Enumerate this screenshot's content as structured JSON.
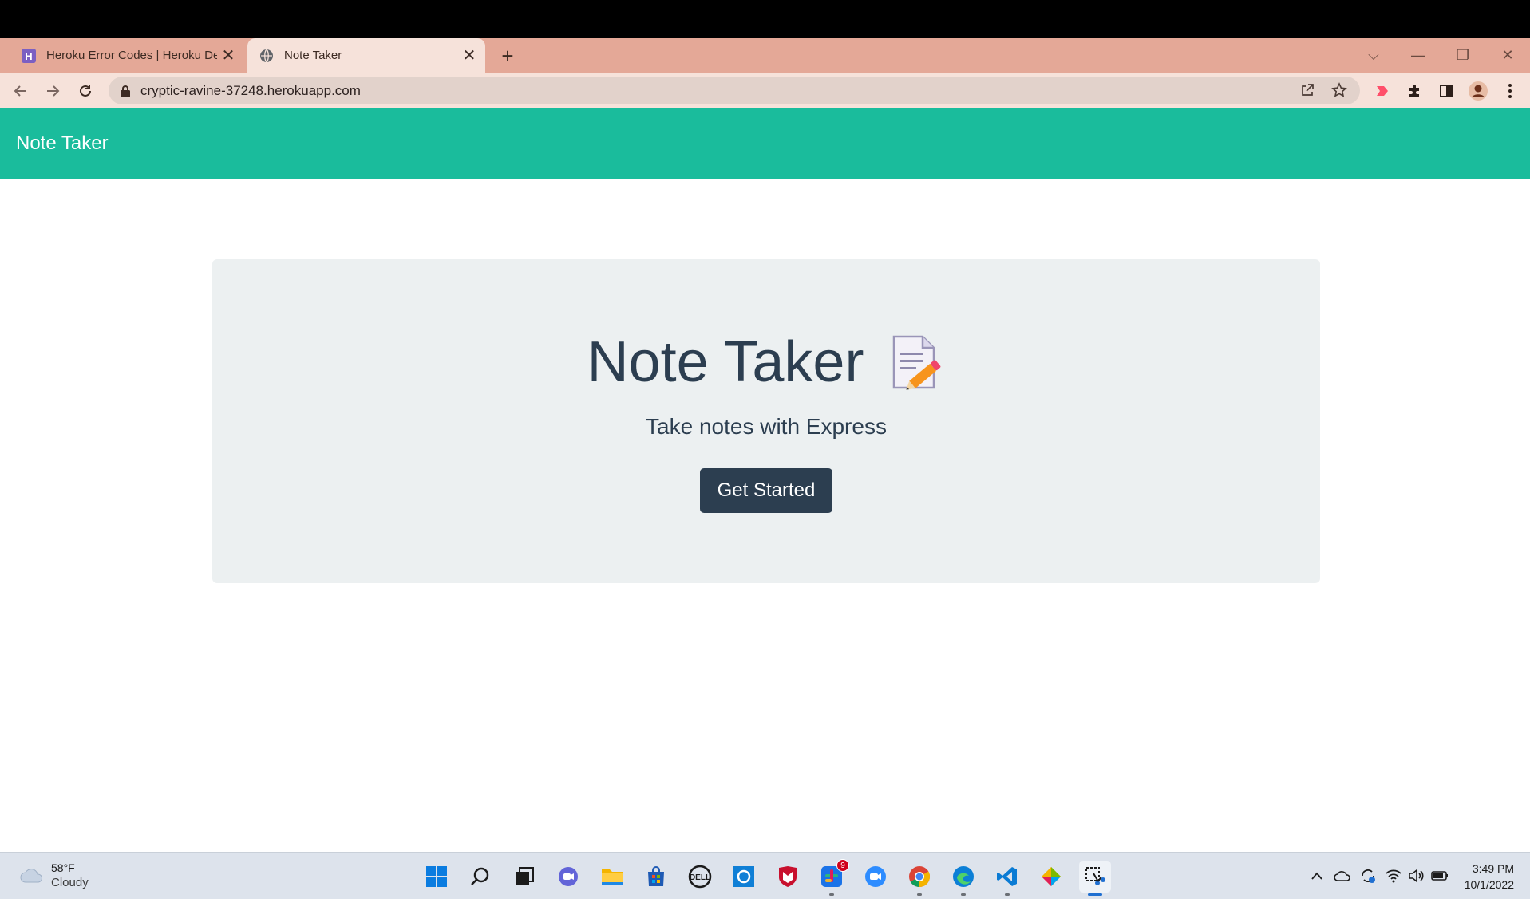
{
  "browser": {
    "tabs": [
      {
        "title": "Heroku Error Codes | Heroku Dev",
        "favicon": "heroku-icon",
        "active": false
      },
      {
        "title": "Note Taker",
        "favicon": "globe-icon",
        "active": true
      }
    ],
    "address": "cryptic-ravine-37248.herokuapp.com"
  },
  "app": {
    "brand": "Note Taker",
    "hero": {
      "title": "Note Taker",
      "emoji": "memo-icon",
      "subtitle": "Take notes with Express",
      "button_label": "Get Started"
    },
    "colors": {
      "navbar": "#1abc9c",
      "jumbotron": "#ecf0f1",
      "button": "#2c3e50"
    }
  },
  "taskbar": {
    "weather": {
      "temp": "58°F",
      "condition": "Cloudy"
    },
    "notification_badge": "9",
    "time": "3:49 PM",
    "date": "10/1/2022"
  }
}
